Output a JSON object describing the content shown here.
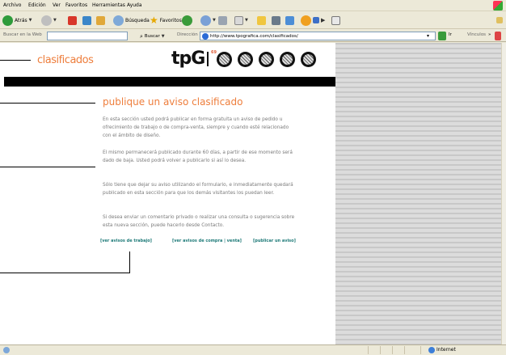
{
  "menubar": {
    "items": [
      "Archivo",
      "Edición",
      "Ver",
      "Favoritos",
      "Herramientas",
      "Ayuda"
    ]
  },
  "toolbar": {
    "back_label": "Atrás",
    "search_label": "Búsqueda",
    "favorites_label": "Favoritos"
  },
  "addressbar": {
    "web_search_label": "Buscar en la Web",
    "search_button": "Buscar",
    "address_label": "Dirección",
    "url": "http://www.tpografica.com/clasificados/",
    "go_label": "Ir",
    "links_label": "Vínculos"
  },
  "page": {
    "section_logo": "clasificados",
    "brand": "tpG",
    "brand_issue": "69",
    "heading": "publique un aviso clasificado",
    "paragraphs": [
      "En esta sección usted podrá publicar en forma gratuita un aviso de pedido u ofrecimiento de trabajo o de compra-venta, siempre y cuando esté relacionado con el ámbito de diseño.",
      "El mismo permanecerá publicado durante 60 días, a partir de ese momento será dado de baja. Usted podrá volver a publicarlo si así lo desea.",
      "Sólo tiene que dejar su aviso utilizando el formulario, e inmediatamente quedará publicado en esta sección para que los demás visitantes los puedan leer.",
      "Si desea enviar un comentario privado o realizar una consulta o sugerencia sobre esta nueva sección, puede hacerlo desde Contacto."
    ],
    "links": [
      "[ver avisos de trabajo]",
      "[ver avisos de compra | venta]",
      "[publicar un aviso]"
    ]
  },
  "statusbar": {
    "zone": "Internet"
  },
  "colors": {
    "accent": "#ee7e3c",
    "link": "#1e7a78",
    "body_text": "#7a7a7a"
  }
}
